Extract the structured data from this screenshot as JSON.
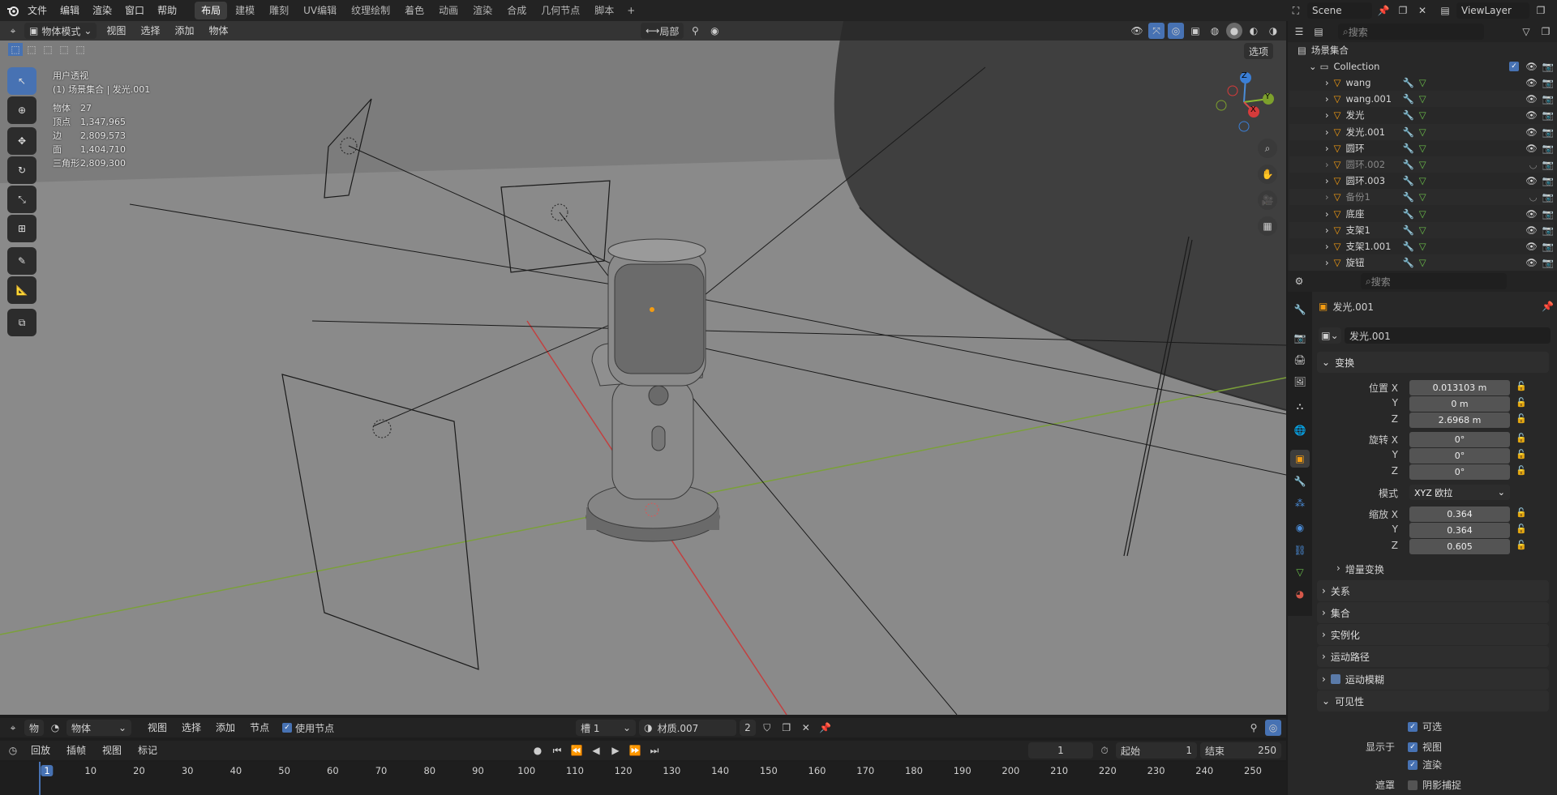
{
  "app": {
    "logo": "blender-logo-icon"
  },
  "topbar": {
    "menus": [
      "文件",
      "编辑",
      "渲染",
      "窗口",
      "帮助"
    ],
    "workspaces": [
      "布局",
      "建模",
      "雕刻",
      "UV编辑",
      "纹理绘制",
      "着色",
      "动画",
      "渲染",
      "合成",
      "几何节点",
      "脚本"
    ],
    "active_workspace": "布局",
    "add_tab": "+",
    "scene_name": "Scene",
    "view_layer": "ViewLayer"
  },
  "viewport_header": {
    "mode": "物体模式",
    "menus": [
      "视图",
      "选择",
      "添加",
      "物体"
    ],
    "pivot": "局部",
    "options": "选项"
  },
  "overlay": {
    "title": "用户透视",
    "subtitle": "(1) 场景集合 | 发光.001",
    "stats": [
      {
        "label": "物体",
        "value": "27"
      },
      {
        "label": "顶点",
        "value": "1,347,965"
      },
      {
        "label": "边",
        "value": "2,809,573"
      },
      {
        "label": "面",
        "value": "1,404,710"
      },
      {
        "label": "三角形",
        "value": "2,809,300"
      }
    ],
    "gizmo": {
      "z": "Z",
      "y": "Y",
      "x": "X"
    }
  },
  "outliner": {
    "search_placeholder": "搜索",
    "root": "场景集合",
    "collection": "Collection",
    "items": [
      {
        "name": "wang",
        "dim": false
      },
      {
        "name": "wang.001",
        "dim": false
      },
      {
        "name": "发光",
        "dim": false
      },
      {
        "name": "发光.001",
        "dim": false
      },
      {
        "name": "圆环",
        "dim": false
      },
      {
        "name": "圆环.002",
        "dim": true
      },
      {
        "name": "圆环.003",
        "dim": false
      },
      {
        "name": "备份1",
        "dim": true
      },
      {
        "name": "底座",
        "dim": false
      },
      {
        "name": "支架1",
        "dim": false
      },
      {
        "name": "支架1.001",
        "dim": false
      },
      {
        "name": "旋钮",
        "dim": false
      }
    ]
  },
  "properties": {
    "search_placeholder": "搜索",
    "object_name": "发光.001",
    "datablock_name": "发光.001",
    "transform_label": "变换",
    "location": {
      "label_x": "位置 X",
      "label_y": "Y",
      "label_z": "Z",
      "x": "0.013103 m",
      "y": "0 m",
      "z": "2.6968 m"
    },
    "rotation": {
      "label_x": "旋转 X",
      "label_y": "Y",
      "label_z": "Z",
      "x": "0°",
      "y": "0°",
      "z": "0°"
    },
    "mode_label": "模式",
    "mode_value": "XYZ 欧拉",
    "scale": {
      "label_x": "缩放 X",
      "label_y": "Y",
      "label_z": "Z",
      "x": "0.364",
      "y": "0.364",
      "z": "0.605"
    },
    "delta_transform": "增量变换",
    "panels": [
      "关系",
      "集合",
      "实例化",
      "运动路径"
    ],
    "motion_blur": "运动模糊",
    "visibility": "可见性",
    "selectable": "可选",
    "show_in": "显示于",
    "viewport": "视图",
    "render": "渲染",
    "mask": "遮罩",
    "shadow_catcher": "阴影捕捉"
  },
  "shader_header": {
    "object_label": "物",
    "object_mode": "物体",
    "menus": [
      "视图",
      "选择",
      "添加",
      "节点"
    ],
    "use_nodes": "使用节点",
    "slot": "槽 1",
    "material": "材质.007",
    "user_count": "2"
  },
  "timeline": {
    "menus": [
      "回放",
      "插帧",
      "视图",
      "标记"
    ],
    "current_frame": "1",
    "start_label": "起始",
    "start": "1",
    "end_label": "结束",
    "end": "250",
    "ticks": [
      "1",
      "10",
      "20",
      "30",
      "40",
      "50",
      "60",
      "70",
      "80",
      "90",
      "100",
      "110",
      "120",
      "130",
      "140",
      "150",
      "160",
      "170",
      "180",
      "190",
      "200",
      "210",
      "220",
      "230",
      "240",
      "250"
    ]
  }
}
